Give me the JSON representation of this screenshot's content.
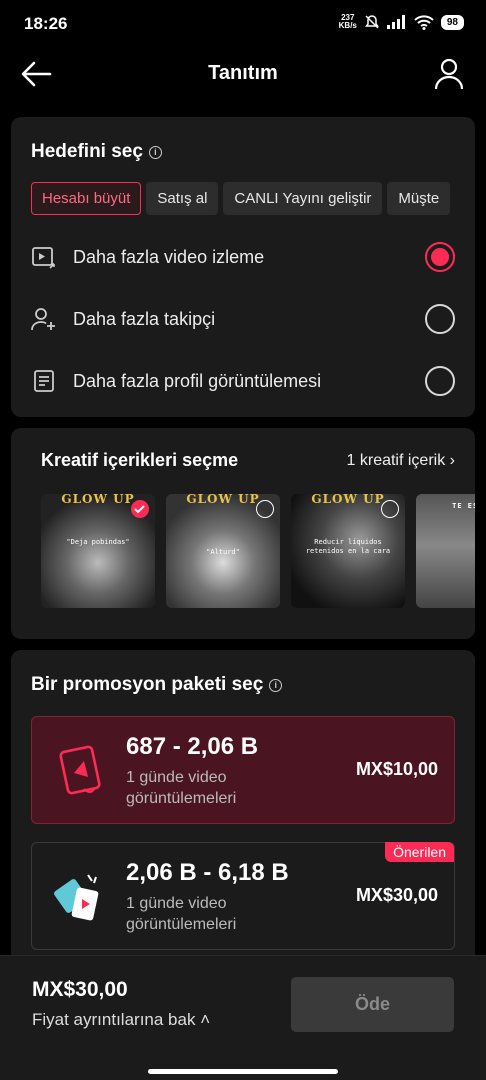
{
  "status_bar": {
    "time": "18:26",
    "speed_value": "237",
    "speed_unit": "KB/s",
    "battery": "98"
  },
  "header": {
    "title": "Tanıtım"
  },
  "goal": {
    "title": "Hedefini seç",
    "chips": [
      "Hesabı büyüt",
      "Satış al",
      "CANLI Yayını geliştir",
      "Müşte"
    ],
    "options": [
      {
        "label": "Daha fazla video izleme",
        "selected": true
      },
      {
        "label": "Daha fazla takipçi",
        "selected": false
      },
      {
        "label": "Daha fazla profil görüntülemesi",
        "selected": false
      }
    ]
  },
  "creative": {
    "title": "Kreatif içerikleri seçme",
    "count_link": "1 kreatif içerik",
    "thumbs": [
      {
        "title": "GLOW UP",
        "caption": "\"Deja pobindas\"",
        "selected": true
      },
      {
        "title": "GLOW UP",
        "caption": "\"Alturd\"",
        "selected": false
      },
      {
        "title": "GLOW UP",
        "caption": "Reducir líquidos retenidos en la cara",
        "selected": false
      },
      {
        "title": "TE ESTAN",
        "caption": "",
        "selected": false
      }
    ]
  },
  "packages": {
    "title": "Bir promosyon paketi seç",
    "items": [
      {
        "range": "687 - 2,06 B",
        "desc_line1": "1 günde video",
        "desc_line2": "görüntülemeleri",
        "price": "MX$10,00",
        "selected": true,
        "badge": ""
      },
      {
        "range": "2,06 B - 6,18 B",
        "desc_line1": "1 günde video",
        "desc_line2": "görüntülemeleri",
        "price": "MX$30,00",
        "selected": false,
        "badge": "Önerilen"
      }
    ]
  },
  "footer": {
    "total": "MX$30,00",
    "details_link": "Fiyat ayrıntılarına bak",
    "pay_label": "Öde"
  },
  "colors": {
    "accent": "#fe2c55",
    "card": "#1b1b1b",
    "selected_pkg": "#4a1520"
  }
}
